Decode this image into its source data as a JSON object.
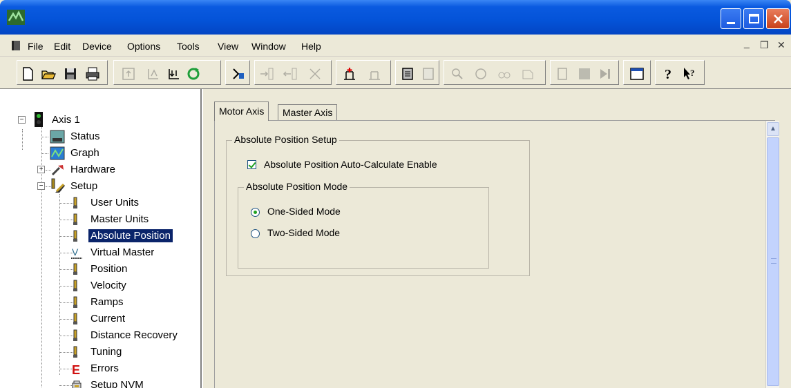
{
  "window": {
    "controls": {
      "minimize": "minimize",
      "maximize": "maximize",
      "close": "close"
    }
  },
  "menu": {
    "items": [
      {
        "label": "File"
      },
      {
        "label": "Edit"
      },
      {
        "label": "Device"
      },
      {
        "label": "Options"
      },
      {
        "label": "Tools"
      },
      {
        "label": "View"
      },
      {
        "label": "Window"
      },
      {
        "label": "Help"
      }
    ],
    "mdi_controls": [
      "minimize-doc",
      "restore-doc",
      "close-doc"
    ]
  },
  "toolbar": {
    "buttons": [
      "new-icon",
      "open-icon",
      "save-icon",
      "print-icon",
      "upload-icon",
      "download-a-icon",
      "download-b-icon",
      "refresh-icon",
      "connect-icon",
      "add-row-icon",
      "insert-icon",
      "delete-icon",
      "add-item-icon",
      "remove-item-icon",
      "document-icon",
      "document-b-icon",
      "zoom-icon",
      "view-a-icon",
      "view-b-icon",
      "view-c-icon",
      "stop-a-icon",
      "stop-b-icon",
      "play-icon",
      "window-icon",
      "help-icon",
      "context-help-icon"
    ]
  },
  "tree": {
    "root": "Axis 1",
    "items": [
      {
        "label": "Status",
        "icon": "status-icon"
      },
      {
        "label": "Graph",
        "icon": "graph-icon"
      },
      {
        "label": "Hardware",
        "icon": "hardware-icon"
      },
      {
        "label": "Setup",
        "icon": "setup-icon"
      },
      {
        "label": "User Units",
        "icon": "param-icon"
      },
      {
        "label": "Master Units",
        "icon": "param-icon"
      },
      {
        "label": "Absolute Position",
        "icon": "param-icon",
        "selected": true
      },
      {
        "label": "Virtual Master",
        "icon": "virtual-master-icon"
      },
      {
        "label": "Position",
        "icon": "param-icon"
      },
      {
        "label": "Velocity",
        "icon": "param-icon"
      },
      {
        "label": "Ramps",
        "icon": "param-icon"
      },
      {
        "label": "Current",
        "icon": "param-icon"
      },
      {
        "label": "Distance Recovery",
        "icon": "param-icon"
      },
      {
        "label": "Tuning",
        "icon": "param-icon"
      },
      {
        "label": "Errors",
        "icon": "errors-icon"
      },
      {
        "label": "Setup NVM",
        "icon": "nvm-icon"
      }
    ]
  },
  "tabs": [
    {
      "label": "Motor Axis",
      "active": true
    },
    {
      "label": "Master Axis",
      "active": false
    }
  ],
  "panel": {
    "group_title": "Absolute Position Setup",
    "checkbox_label": "Absolute Position Auto-Calculate Enable",
    "checkbox_checked": true,
    "mode_group_title": "Absolute Position Mode",
    "mode_options": [
      {
        "label": "One-Sided Mode",
        "selected": true
      },
      {
        "label": "Two-Sided Mode",
        "selected": false
      }
    ]
  },
  "colors": {
    "titlebar": "#0453d8",
    "selection": "#0a246a",
    "close": "#c8411b"
  }
}
